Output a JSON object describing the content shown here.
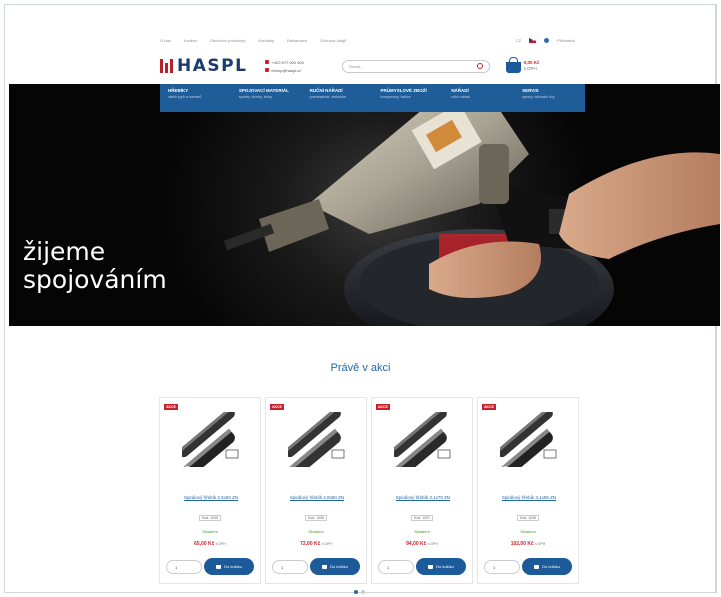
{
  "topbar": {
    "links": [
      "O nás",
      "Kariéra",
      "Obchodní podmínky",
      "Kontakty",
      "Reklamace",
      "Ochrana údajů"
    ],
    "lang": "CZ",
    "login": "Přihlášení"
  },
  "header": {
    "brand": "HASPL",
    "phone": "+420 577 000 000",
    "email": "eshop@haspl.cz",
    "search_placeholder": "Hledat...",
    "cart_price": "0,00 Kč",
    "cart_sub": "s DPH"
  },
  "menu": [
    {
      "title": "HŘEBÍKY",
      "sub": "všech typů a rozměrů"
    },
    {
      "title": "SPOJOVACÍ MATERIÁL",
      "sub": "sponky, šrouby, kotvy"
    },
    {
      "title": "RUČNÍ NÁŘADÍ",
      "sub": "pneumatické, elektrické"
    },
    {
      "title": "PRŮMYSLOVÉ ZBOŽÍ",
      "sub": "kompresory, hadice"
    },
    {
      "title": "NÁŘADÍ",
      "sub": "ruční nářadí"
    },
    {
      "title": "SERVIS",
      "sub": "opravy, náhradní díly"
    }
  ],
  "hero": {
    "slogan_line1": "žijeme",
    "slogan_line2": "spojováním"
  },
  "section_title": "Právě v akci",
  "products": [
    {
      "badge": "AKCE",
      "name": "Spirálový hřebík 2,5x50 ZN",
      "code": "Kód: 1005",
      "stock": "Skladem",
      "price": "65,00 Kč",
      "price_note": "s DPH",
      "qty": "1",
      "button": "Do košíku"
    },
    {
      "badge": "AKCE",
      "name": "Spirálový hřebík 2,8x60 ZN",
      "code": "Kód: 1006",
      "stock": "Skladem",
      "price": "72,00 Kč",
      "price_note": "s DPH",
      "qty": "1",
      "button": "Do košíku"
    },
    {
      "badge": "AKCE",
      "name": "Spirálový hřebík 3,1x70 ZN",
      "code": "Kód: 1007",
      "stock": "Skladem",
      "price": "94,00 Kč",
      "price_note": "s DPH",
      "qty": "1",
      "button": "Do košíku"
    },
    {
      "badge": "AKCE",
      "name": "Spirálový hřebík 3,1x90 ZN",
      "code": "Kód: 1008",
      "stock": "Skladem",
      "price": "102,00 Kč",
      "price_note": "s DPH",
      "qty": "1",
      "button": "Do košíku"
    }
  ],
  "colors": {
    "brand_blue": "#1e5d98",
    "brand_red": "#c8232c",
    "link_blue": "#2366a8",
    "stock_green": "#4a9a2a"
  }
}
